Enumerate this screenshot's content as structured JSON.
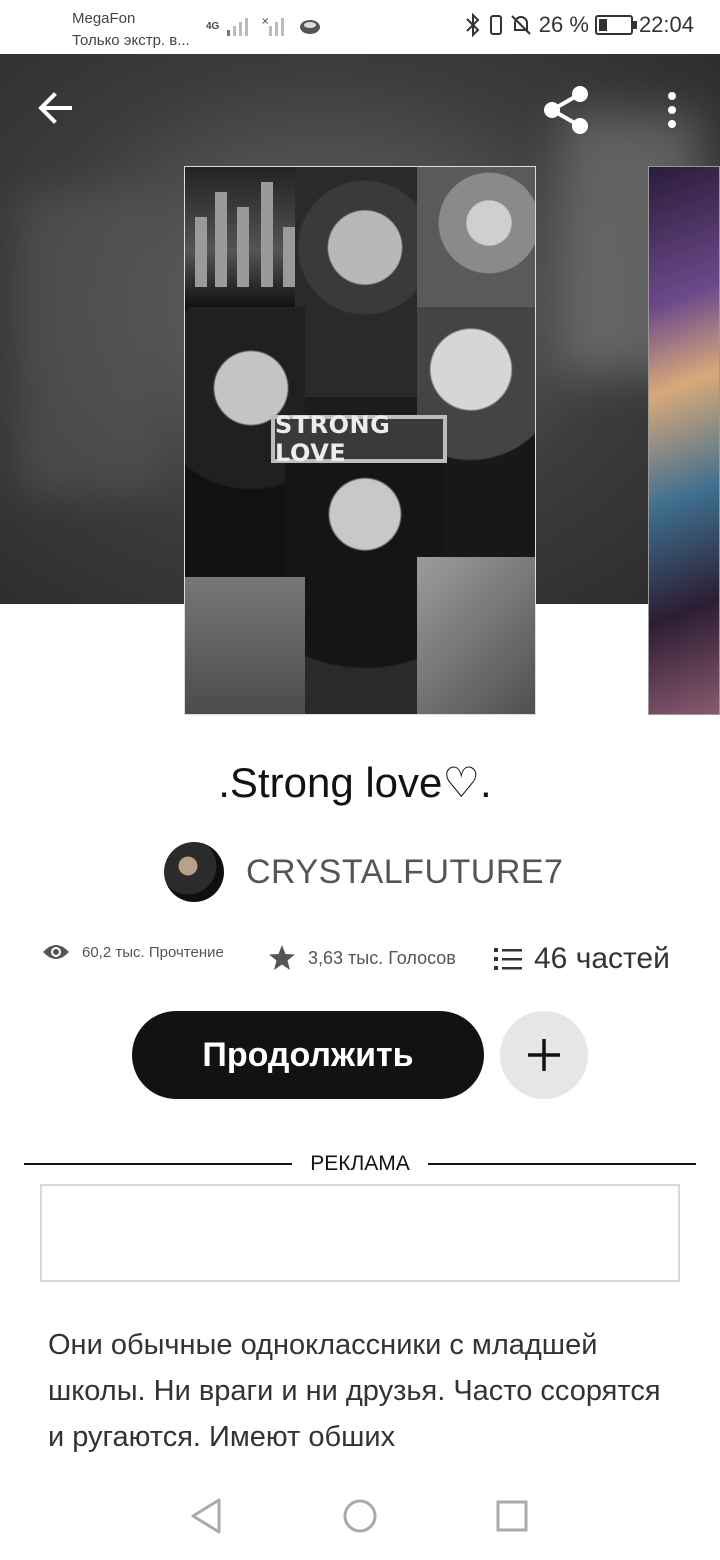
{
  "status_bar": {
    "carrier": "MegaFon",
    "carrier_note": "Только экстр. в...",
    "network": "4G",
    "battery_percent": "26 %",
    "battery_level": 0.26,
    "time": "22:04"
  },
  "header": {
    "back_icon": "arrow-left-icon",
    "share_icon": "share-icon",
    "more_icon": "more-vertical-icon"
  },
  "cover": {
    "title_text": "STRONG LOVE"
  },
  "story": {
    "title": ".Strong love♡.",
    "author": "CRYSTALFUTURE7"
  },
  "stats": {
    "reads": "60,2 тыс. Прочтение",
    "votes": "3,63 тыс. Голосов",
    "parts": "46 частей"
  },
  "actions": {
    "continue_label": "Продолжить",
    "add_icon": "plus-icon"
  },
  "ad": {
    "label": "РЕКЛАМА"
  },
  "description": "Они обычные одноклассники с младшей школы. Ни враги и ни друзья. Часто ссорятся и ругаются. Имеют обших",
  "nav": {
    "back": "triangle-back-icon",
    "home": "circle-home-icon",
    "recents": "square-recents-icon"
  },
  "colors": {
    "accent_dark": "#121212",
    "add_button_bg": "#e6e6e6"
  }
}
